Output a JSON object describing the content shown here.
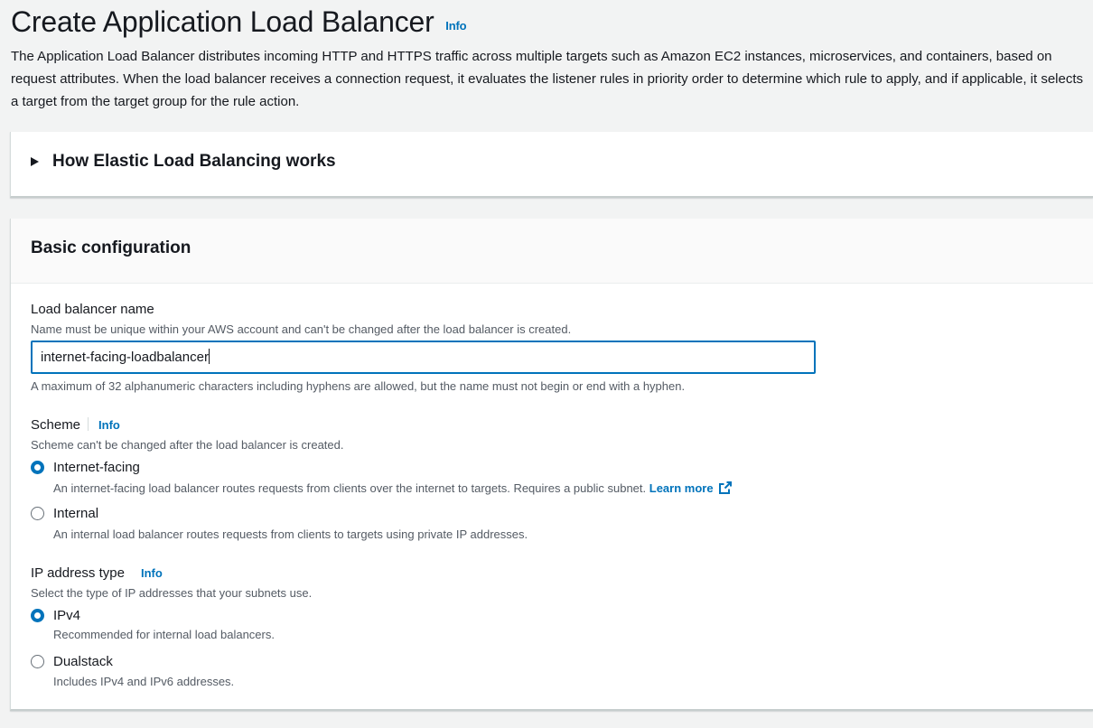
{
  "header": {
    "title": "Create Application Load Balancer",
    "info": "Info",
    "description": "The Application Load Balancer distributes incoming HTTP and HTTPS traffic across multiple targets such as Amazon EC2 instances, microservices, and containers, based on request attributes. When the load balancer receives a connection request, it evaluates the listener rules in priority order to determine which rule to apply, and if applicable, it selects a target from the target group for the rule action."
  },
  "how_it_works": {
    "label": "How Elastic Load Balancing works"
  },
  "basic_config": {
    "heading": "Basic configuration",
    "name_field": {
      "label": "Load balancer name",
      "description": "Name must be unique within your AWS account and can't be changed after the load balancer is created.",
      "value": "internet-facing-loadbalancer",
      "constraint": "A maximum of 32 alphanumeric characters including hyphens are allowed, but the name must not begin or end with a hyphen."
    },
    "scheme": {
      "label": "Scheme",
      "info": "Info",
      "description": "Scheme can't be changed after the load balancer is created.",
      "options": [
        {
          "label": "Internet-facing",
          "description": "An internet-facing load balancer routes requests from clients over the internet to targets. Requires a public subnet.",
          "link": "Learn more",
          "selected": true
        },
        {
          "label": "Internal",
          "description": "An internal load balancer routes requests from clients to targets using private IP addresses.",
          "selected": false
        }
      ]
    },
    "ip_type": {
      "label": "IP address type",
      "info": "Info",
      "description": "Select the type of IP addresses that your subnets use.",
      "options": [
        {
          "label": "IPv4",
          "description": "Recommended for internal load balancers.",
          "selected": true
        },
        {
          "label": "Dualstack",
          "description": "Includes IPv4 and IPv6 addresses.",
          "selected": false
        }
      ]
    }
  },
  "colors": {
    "accent": "#0073bb",
    "text": "#16191f",
    "muted": "#545b64",
    "background": "#f2f3f3"
  }
}
